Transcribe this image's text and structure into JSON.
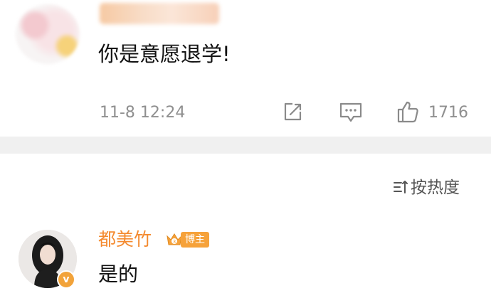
{
  "comment": {
    "text": "你是意愿退学!",
    "timestamp": "11-8 12:24",
    "like_count": "1716",
    "icons": [
      "share-icon",
      "comment-icon",
      "like-icon"
    ]
  },
  "sort": {
    "label": "按热度",
    "icon": "sort-icon"
  },
  "reply": {
    "author": "都美竹",
    "badge": "博主",
    "verified_mark": "v",
    "text": "是的"
  },
  "colors": {
    "author_name": "#f48a2f",
    "badge_bg": "#f6a23a",
    "meta_text": "#8f8f8f",
    "divider": "#f0f0f0"
  }
}
